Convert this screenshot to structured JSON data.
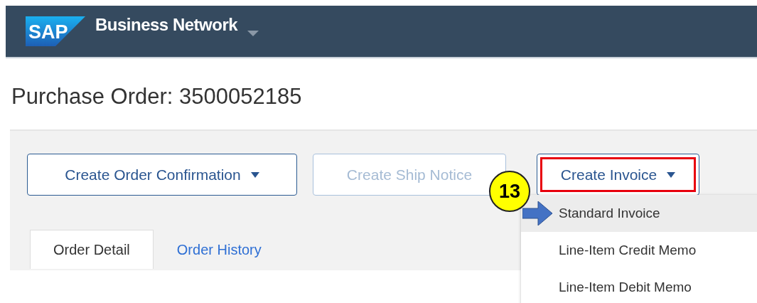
{
  "header": {
    "logo": "SAP",
    "title": "Business Network"
  },
  "page_title": "Purchase Order: 3500052185",
  "actions": [
    {
      "label": "Create Order Confirmation",
      "disabled": false,
      "dropdown": true,
      "highlighted": false
    },
    {
      "label": "Create Ship Notice",
      "disabled": true,
      "dropdown": false,
      "highlighted": false
    },
    {
      "label": "Create Invoice",
      "disabled": false,
      "dropdown": true,
      "highlighted": true
    }
  ],
  "step_badge": "13",
  "menu": [
    {
      "label": "Standard Invoice",
      "selected": true
    },
    {
      "label": "Line-Item Credit Memo",
      "selected": false
    },
    {
      "label": "Line-Item Debit Memo",
      "selected": false
    }
  ],
  "tabs": [
    {
      "label": "Order Detail",
      "selected": true
    },
    {
      "label": "Order History",
      "selected": false
    }
  ]
}
